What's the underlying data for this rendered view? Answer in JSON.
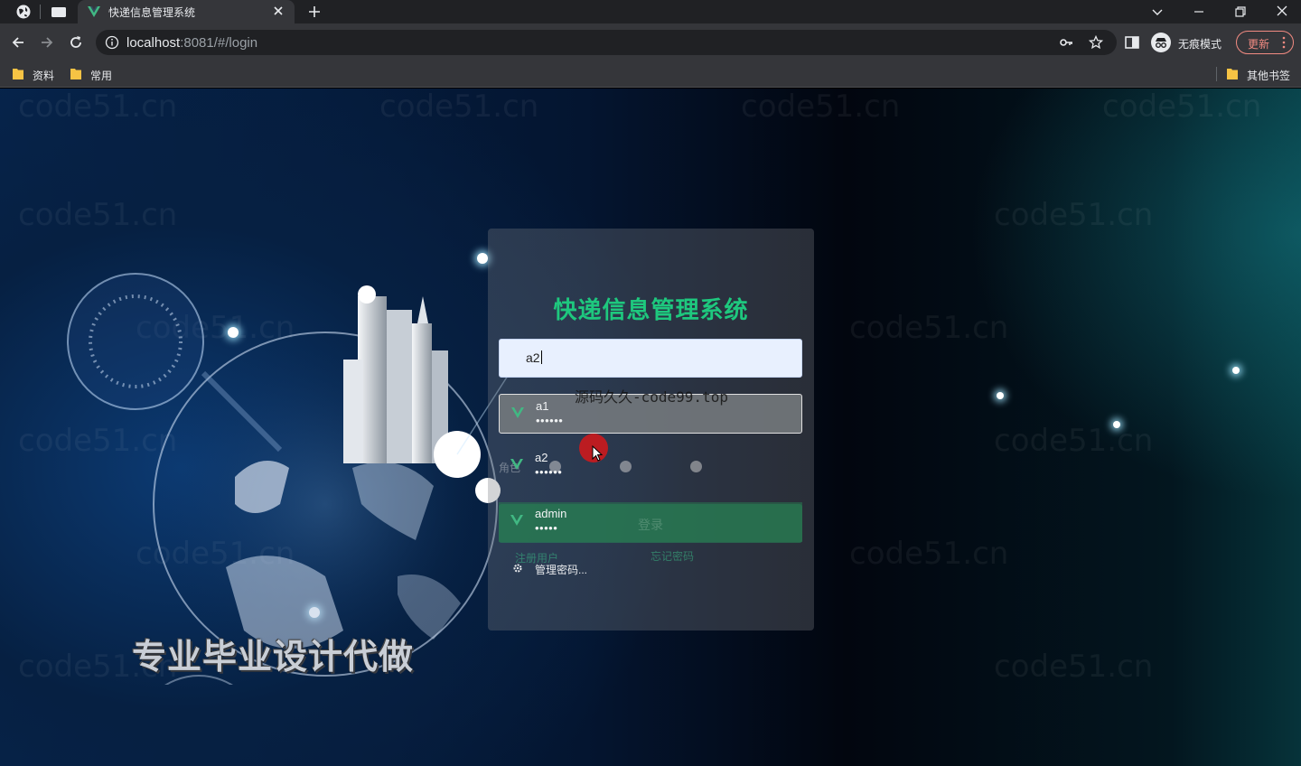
{
  "browser": {
    "tab_title": "快递信息管理系统",
    "url_host": "localhost",
    "url_rest": ":8081/#/login",
    "incognito_label": "无痕模式",
    "update_label": "更新",
    "bookmarks": [
      "资料",
      "常用"
    ],
    "other_bookmarks": "其他书签"
  },
  "login": {
    "title": "快递信息管理系统",
    "username_value": "a2",
    "role_label": "角色",
    "login_button": "登录",
    "register_link": "注册用户",
    "forgot_link": "忘记密码"
  },
  "autofill": {
    "accounts": [
      {
        "user": "a1",
        "pass": "••••••"
      },
      {
        "user": "a2",
        "pass": "••••••"
      },
      {
        "user": "admin",
        "pass": "•••••"
      }
    ],
    "manage_label": "管理密码..."
  },
  "overlay": {
    "watermark_text": "code51.cn",
    "site_text": "源码久久-code99.top",
    "promo_text": "专业毕业设计代做"
  },
  "colors": {
    "accent_green": "#1ec87e",
    "chrome_dark": "#202124",
    "chrome_toolbar": "#35363a",
    "update_red": "#f28b82"
  }
}
